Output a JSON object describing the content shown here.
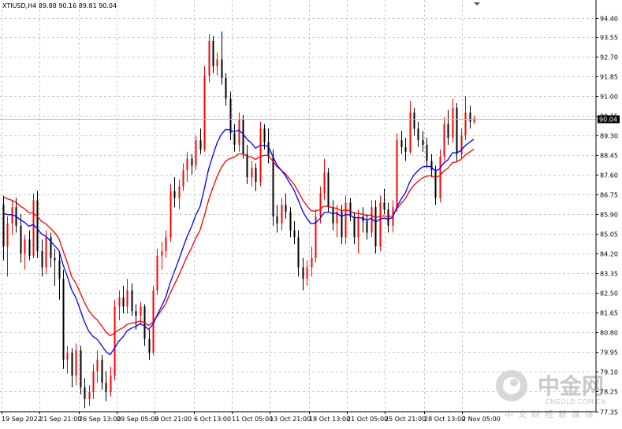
{
  "header": {
    "symbol_info": "XTIUSD,H4  89.88 90.16 89.81 90.04"
  },
  "last_price_label": "90.04",
  "watermark": {
    "cn": "中金网",
    "en": "CNGOLD.COM.CN",
    "sub": "中文财经新媒体"
  },
  "colors": {
    "bull": "#ff0000",
    "bear": "#000000",
    "ma_fast": "#0000ff",
    "ma_slow": "#ff0000",
    "price_tag_bg": "#000000"
  },
  "chart_data": {
    "type": "candlestick",
    "symbol": "XTIUSD",
    "timeframe": "H4",
    "ylim": [
      77.35,
      95.1
    ],
    "y_ticks": [
      "94.40",
      "93.55",
      "92.70",
      "91.85",
      "91.00",
      "90.15",
      "89.30",
      "88.45",
      "87.60",
      "86.75",
      "85.90",
      "85.05",
      "84.20",
      "83.35",
      "82.50",
      "81.65",
      "80.80",
      "79.95",
      "79.10",
      "78.25",
      "77.35"
    ],
    "x_tick_labels": [
      "19 Sep 2022",
      "21 Sep 21:00",
      "26 Sep 13:00",
      "29 Sep 05:00",
      "3 Oct 21:00",
      "6 Oct 13:00",
      "11 Oct 05:00",
      "13 Oct 21:00",
      "18 Oct 13:00",
      "21 Oct 05:00",
      "25 Oct 21:00",
      "28 Oct 13:00",
      "2 Nov 05:00"
    ],
    "grid": true,
    "last_price": 90.04,
    "candles": [
      {
        "o": 86.3,
        "h": 86.7,
        "l": 83.9,
        "c": 84.5
      },
      {
        "o": 84.5,
        "h": 85.8,
        "l": 83.2,
        "c": 85.5
      },
      {
        "o": 85.5,
        "h": 86.5,
        "l": 85.0,
        "c": 86.2
      },
      {
        "o": 86.2,
        "h": 86.6,
        "l": 85.1,
        "c": 85.4
      },
      {
        "o": 85.4,
        "h": 85.9,
        "l": 83.8,
        "c": 84.2
      },
      {
        "o": 84.2,
        "h": 85.0,
        "l": 83.5,
        "c": 84.8
      },
      {
        "o": 84.8,
        "h": 85.2,
        "l": 83.9,
        "c": 84.1
      },
      {
        "o": 84.1,
        "h": 86.8,
        "l": 84.0,
        "c": 86.5
      },
      {
        "o": 86.5,
        "h": 86.9,
        "l": 84.0,
        "c": 84.3
      },
      {
        "o": 84.3,
        "h": 84.8,
        "l": 83.2,
        "c": 83.6
      },
      {
        "o": 83.6,
        "h": 85.2,
        "l": 83.3,
        "c": 84.9
      },
      {
        "o": 84.9,
        "h": 85.1,
        "l": 83.6,
        "c": 84.0
      },
      {
        "o": 84.0,
        "h": 84.4,
        "l": 82.8,
        "c": 83.9
      },
      {
        "o": 83.9,
        "h": 84.3,
        "l": 82.2,
        "c": 83.1
      },
      {
        "o": 83.1,
        "h": 83.5,
        "l": 79.2,
        "c": 79.6
      },
      {
        "o": 79.6,
        "h": 80.2,
        "l": 79.0,
        "c": 79.9
      },
      {
        "o": 79.9,
        "h": 80.1,
        "l": 78.4,
        "c": 78.9
      },
      {
        "o": 78.9,
        "h": 80.3,
        "l": 78.5,
        "c": 80.0
      },
      {
        "o": 80.0,
        "h": 80.2,
        "l": 78.1,
        "c": 78.4
      },
      {
        "o": 78.4,
        "h": 78.8,
        "l": 77.5,
        "c": 77.9
      },
      {
        "o": 77.9,
        "h": 78.5,
        "l": 77.6,
        "c": 78.2
      },
      {
        "o": 78.2,
        "h": 79.4,
        "l": 77.9,
        "c": 79.1
      },
      {
        "o": 79.1,
        "h": 80.0,
        "l": 78.6,
        "c": 79.6
      },
      {
        "o": 79.6,
        "h": 79.8,
        "l": 78.3,
        "c": 78.6
      },
      {
        "o": 78.6,
        "h": 79.1,
        "l": 77.8,
        "c": 78.2
      },
      {
        "o": 78.2,
        "h": 79.3,
        "l": 78.0,
        "c": 78.9
      },
      {
        "o": 78.9,
        "h": 82.2,
        "l": 78.7,
        "c": 81.9
      },
      {
        "o": 81.9,
        "h": 82.6,
        "l": 81.3,
        "c": 82.3
      },
      {
        "o": 82.3,
        "h": 82.8,
        "l": 81.6,
        "c": 81.9
      },
      {
        "o": 81.9,
        "h": 83.1,
        "l": 81.6,
        "c": 82.6
      },
      {
        "o": 82.6,
        "h": 82.9,
        "l": 81.5,
        "c": 81.7
      },
      {
        "o": 81.7,
        "h": 82.0,
        "l": 80.9,
        "c": 81.5
      },
      {
        "o": 81.5,
        "h": 82.1,
        "l": 81.1,
        "c": 81.9
      },
      {
        "o": 81.9,
        "h": 82.0,
        "l": 80.2,
        "c": 80.5
      },
      {
        "o": 80.5,
        "h": 80.9,
        "l": 79.6,
        "c": 79.9
      },
      {
        "o": 79.9,
        "h": 82.8,
        "l": 79.8,
        "c": 82.6
      },
      {
        "o": 82.6,
        "h": 84.4,
        "l": 82.4,
        "c": 84.1
      },
      {
        "o": 84.1,
        "h": 84.7,
        "l": 83.5,
        "c": 84.3
      },
      {
        "o": 84.3,
        "h": 85.2,
        "l": 84.0,
        "c": 84.9
      },
      {
        "o": 84.9,
        "h": 87.2,
        "l": 84.7,
        "c": 86.9
      },
      {
        "o": 86.9,
        "h": 87.5,
        "l": 86.2,
        "c": 86.6
      },
      {
        "o": 86.6,
        "h": 87.4,
        "l": 86.1,
        "c": 87.1
      },
      {
        "o": 87.1,
        "h": 88.1,
        "l": 86.9,
        "c": 87.8
      },
      {
        "o": 87.8,
        "h": 88.6,
        "l": 87.3,
        "c": 88.3
      },
      {
        "o": 88.3,
        "h": 88.5,
        "l": 87.6,
        "c": 88.0
      },
      {
        "o": 88.0,
        "h": 89.3,
        "l": 87.8,
        "c": 89.1
      },
      {
        "o": 89.1,
        "h": 89.6,
        "l": 88.5,
        "c": 88.7
      },
      {
        "o": 88.7,
        "h": 92.3,
        "l": 88.6,
        "c": 91.9
      },
      {
        "o": 91.9,
        "h": 93.7,
        "l": 91.6,
        "c": 93.4
      },
      {
        "o": 93.4,
        "h": 93.6,
        "l": 92.0,
        "c": 92.3
      },
      {
        "o": 92.3,
        "h": 92.9,
        "l": 91.9,
        "c": 92.6
      },
      {
        "o": 92.6,
        "h": 93.8,
        "l": 91.5,
        "c": 91.8
      },
      {
        "o": 91.8,
        "h": 92.0,
        "l": 90.6,
        "c": 90.9
      },
      {
        "o": 90.9,
        "h": 91.2,
        "l": 89.1,
        "c": 89.4
      },
      {
        "o": 89.4,
        "h": 89.8,
        "l": 88.6,
        "c": 88.9
      },
      {
        "o": 88.9,
        "h": 90.3,
        "l": 88.6,
        "c": 90.0
      },
      {
        "o": 90.0,
        "h": 90.2,
        "l": 88.3,
        "c": 88.5
      },
      {
        "o": 88.5,
        "h": 88.9,
        "l": 87.2,
        "c": 87.5
      },
      {
        "o": 87.5,
        "h": 88.2,
        "l": 87.1,
        "c": 87.9
      },
      {
        "o": 87.9,
        "h": 88.1,
        "l": 86.9,
        "c": 87.3
      },
      {
        "o": 87.3,
        "h": 89.9,
        "l": 87.1,
        "c": 89.6
      },
      {
        "o": 89.6,
        "h": 89.8,
        "l": 88.7,
        "c": 89.0
      },
      {
        "o": 89.0,
        "h": 89.6,
        "l": 88.1,
        "c": 88.4
      },
      {
        "o": 88.4,
        "h": 88.7,
        "l": 85.4,
        "c": 85.8
      },
      {
        "o": 85.8,
        "h": 86.3,
        "l": 85.1,
        "c": 85.5
      },
      {
        "o": 85.5,
        "h": 86.6,
        "l": 85.2,
        "c": 86.3
      },
      {
        "o": 86.3,
        "h": 86.8,
        "l": 85.7,
        "c": 86.0
      },
      {
        "o": 86.0,
        "h": 86.2,
        "l": 84.9,
        "c": 85.2
      },
      {
        "o": 85.2,
        "h": 85.6,
        "l": 84.6,
        "c": 84.9
      },
      {
        "o": 84.9,
        "h": 85.2,
        "l": 83.2,
        "c": 83.6
      },
      {
        "o": 83.6,
        "h": 84.0,
        "l": 82.6,
        "c": 83.1
      },
      {
        "o": 83.1,
        "h": 83.9,
        "l": 82.8,
        "c": 83.6
      },
      {
        "o": 83.6,
        "h": 84.5,
        "l": 83.2,
        "c": 84.0
      },
      {
        "o": 84.0,
        "h": 86.1,
        "l": 83.8,
        "c": 85.8
      },
      {
        "o": 85.8,
        "h": 87.1,
        "l": 85.5,
        "c": 86.8
      },
      {
        "o": 86.8,
        "h": 88.3,
        "l": 86.5,
        "c": 87.7
      },
      {
        "o": 87.7,
        "h": 87.9,
        "l": 86.0,
        "c": 86.2
      },
      {
        "o": 86.2,
        "h": 86.5,
        "l": 85.2,
        "c": 85.5
      },
      {
        "o": 85.5,
        "h": 86.3,
        "l": 84.9,
        "c": 86.0
      },
      {
        "o": 86.0,
        "h": 86.3,
        "l": 84.6,
        "c": 84.9
      },
      {
        "o": 84.9,
        "h": 86.7,
        "l": 84.6,
        "c": 86.4
      },
      {
        "o": 86.4,
        "h": 86.6,
        "l": 85.6,
        "c": 85.8
      },
      {
        "o": 85.8,
        "h": 86.0,
        "l": 84.6,
        "c": 84.9
      },
      {
        "o": 84.9,
        "h": 86.1,
        "l": 84.2,
        "c": 85.8
      },
      {
        "o": 85.8,
        "h": 86.2,
        "l": 85.1,
        "c": 85.6
      },
      {
        "o": 85.6,
        "h": 85.9,
        "l": 84.8,
        "c": 85.1
      },
      {
        "o": 85.1,
        "h": 86.5,
        "l": 84.9,
        "c": 86.2
      },
      {
        "o": 86.2,
        "h": 86.5,
        "l": 84.2,
        "c": 84.5
      },
      {
        "o": 84.5,
        "h": 86.7,
        "l": 84.3,
        "c": 86.4
      },
      {
        "o": 86.4,
        "h": 87.0,
        "l": 85.9,
        "c": 86.1
      },
      {
        "o": 86.1,
        "h": 86.4,
        "l": 85.1,
        "c": 85.4
      },
      {
        "o": 85.4,
        "h": 86.5,
        "l": 85.1,
        "c": 86.2
      },
      {
        "o": 86.2,
        "h": 89.4,
        "l": 86.0,
        "c": 89.1
      },
      {
        "o": 89.1,
        "h": 89.5,
        "l": 88.5,
        "c": 88.8
      },
      {
        "o": 88.8,
        "h": 89.2,
        "l": 88.2,
        "c": 88.6
      },
      {
        "o": 88.6,
        "h": 90.8,
        "l": 88.5,
        "c": 90.3
      },
      {
        "o": 90.3,
        "h": 90.5,
        "l": 89.3,
        "c": 89.6
      },
      {
        "o": 89.6,
        "h": 89.9,
        "l": 88.8,
        "c": 89.1
      },
      {
        "o": 89.1,
        "h": 89.5,
        "l": 88.6,
        "c": 88.9
      },
      {
        "o": 88.9,
        "h": 89.2,
        "l": 87.9,
        "c": 88.2
      },
      {
        "o": 88.2,
        "h": 88.5,
        "l": 87.5,
        "c": 87.8
      },
      {
        "o": 87.8,
        "h": 88.0,
        "l": 86.3,
        "c": 86.6
      },
      {
        "o": 86.6,
        "h": 88.7,
        "l": 86.4,
        "c": 88.4
      },
      {
        "o": 88.4,
        "h": 90.1,
        "l": 88.2,
        "c": 89.8
      },
      {
        "o": 89.8,
        "h": 90.4,
        "l": 88.9,
        "c": 89.2
      },
      {
        "o": 89.2,
        "h": 90.9,
        "l": 89.0,
        "c": 90.5
      },
      {
        "o": 90.5,
        "h": 90.7,
        "l": 88.2,
        "c": 88.5
      },
      {
        "o": 88.5,
        "h": 89.6,
        "l": 88.3,
        "c": 89.3
      },
      {
        "o": 89.3,
        "h": 91.0,
        "l": 89.1,
        "c": 90.3
      },
      {
        "o": 90.3,
        "h": 90.6,
        "l": 89.6,
        "c": 89.9
      },
      {
        "o": 89.88,
        "h": 90.16,
        "l": 89.81,
        "c": 90.04
      }
    ]
  }
}
